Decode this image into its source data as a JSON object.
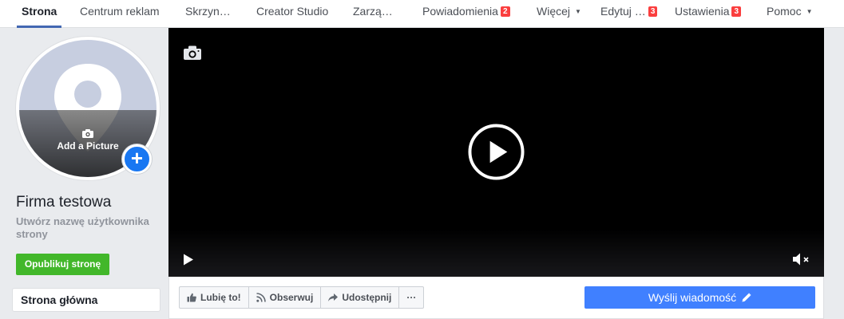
{
  "nav": {
    "items": [
      {
        "label": "Strona",
        "badge": "",
        "caret": false
      },
      {
        "label": "Centrum reklam",
        "badge": "",
        "caret": false
      },
      {
        "label": "Skrzyn…",
        "badge": "",
        "caret": false
      },
      {
        "label": "Creator Studio",
        "badge": "",
        "caret": false
      },
      {
        "label": "Zarzą…",
        "badge": "",
        "caret": false
      },
      {
        "label": "Powiadomienia",
        "badge": "2",
        "caret": false
      },
      {
        "label": "Więcej",
        "badge": "",
        "caret": true
      },
      {
        "label": "Edytuj …",
        "badge": "3",
        "caret": false
      },
      {
        "label": "Ustawienia",
        "badge": "3",
        "caret": false
      },
      {
        "label": "Pomoc",
        "badge": "",
        "caret": true
      }
    ],
    "caret_glyph": "▼",
    "active_color": "#4267b2",
    "badge_color": "#fa3e3e"
  },
  "profile": {
    "add_picture_label": "Add a Picture",
    "add_icon": "+",
    "page_name": "Firma testowa",
    "username_prompt": "Utwórz nazwę użytkownika strony",
    "publish_label": "Opublikuj stronę",
    "publish_color": "#42b72a"
  },
  "sidebar": {
    "items": [
      {
        "label": "Strona główna"
      }
    ]
  },
  "cover": {
    "background": "#000000",
    "icons": [
      "camera-icon",
      "play-icon",
      "mute-icon"
    ]
  },
  "actions": {
    "like_label": "Lubię to!",
    "follow_label": "Obserwuj",
    "share_label": "Udostępnij",
    "more_label": "···",
    "send_message_label": "Wyślij wiadomość",
    "send_color": "#4080ff"
  }
}
